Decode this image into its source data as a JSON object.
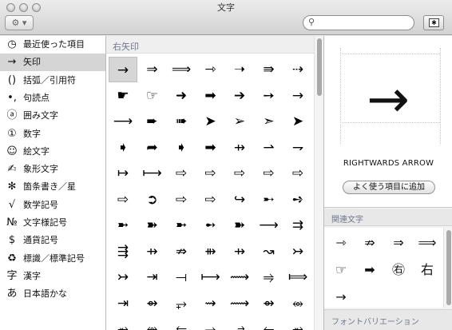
{
  "window": {
    "title": "文字"
  },
  "toolbar": {
    "gear_label": "⚙ ▾",
    "search_placeholder": "",
    "view_toggle_label": "✱"
  },
  "sidebar": {
    "selected_index": 1,
    "items": [
      {
        "icon": "◷",
        "icon_name": "clock-icon",
        "label": "最近使った項目"
      },
      {
        "icon": "→",
        "icon_name": "arrow-icon",
        "label": "矢印"
      },
      {
        "icon": "()",
        "icon_name": "parentheses-icon",
        "label": "括弧／引用符"
      },
      {
        "icon": "•,",
        "icon_name": "punctuation-icon",
        "label": "句読点"
      },
      {
        "icon": "ⓐ",
        "icon_name": "enclosed-letter-icon",
        "label": "囲み文字"
      },
      {
        "icon": "①",
        "icon_name": "digit-icon",
        "label": "数字"
      },
      {
        "icon": "☺",
        "icon_name": "smiley-icon",
        "label": "絵文字"
      },
      {
        "icon": "✍",
        "icon_name": "writing-hand-icon",
        "label": "象形文字"
      },
      {
        "icon": "✻",
        "icon_name": "asterisk-icon",
        "label": "箇条書き／星"
      },
      {
        "icon": "√",
        "icon_name": "square-root-icon",
        "label": "数学記号"
      },
      {
        "icon": "№",
        "icon_name": "numero-icon",
        "label": "文字様記号"
      },
      {
        "icon": "$",
        "icon_name": "dollar-icon",
        "label": "通貨記号"
      },
      {
        "icon": "♻",
        "icon_name": "recycle-icon",
        "label": "標識／標準記号"
      },
      {
        "icon": "字",
        "icon_name": "kanji-icon",
        "label": "漢字"
      },
      {
        "icon": "あ",
        "icon_name": "hiragana-icon",
        "label": "日本語かな"
      }
    ]
  },
  "main": {
    "section_title": "右矢印",
    "selected_char_index": 0,
    "characters": [
      "→",
      "⇒",
      "⟹",
      "⇾",
      "➝",
      "⇛",
      "⇢",
      "☛",
      "☞",
      "➜",
      "➡",
      "➔",
      "➙",
      "→",
      "⟶",
      "➨",
      "➠",
      "➤",
      "➢",
      "➣",
      "➤",
      "➧",
      "➦",
      "➧",
      "➡",
      "⇸",
      "⇀",
      "⇁",
      "↦",
      "⟼",
      "⇨",
      "⇨",
      "⇨",
      "⇨",
      "⇨",
      "⇨",
      "➲",
      "⇨",
      "⇨",
      "↪",
      "➸",
      "➺",
      "➼",
      "➽",
      "➼",
      "➻",
      "➽",
      "⟶",
      "⇉",
      "⇶",
      "⇸",
      "⇏",
      "⇻",
      "⇸",
      "↝",
      "↣",
      "↣",
      "⇥",
      "⟞",
      "⟼",
      "⟿",
      "⥤",
      "⟾",
      "⇥",
      "⇴",
      "⥅",
      "⇝",
      "⟿",
      "⇴",
      "⥈",
      "⥇",
      "⥈",
      "⥃",
      "⥅",
      "⥄",
      "⥆",
      "⥇"
    ]
  },
  "detail": {
    "glyph": "→",
    "char_name": "RIGHTWARDS ARROW",
    "fav_button_label": "よく使う項目に追加",
    "related_title": "関連文字",
    "related": [
      "⇾",
      "⇏",
      "⇒",
      "⟹",
      "☞",
      "➡",
      "㊨",
      "右",
      "→"
    ],
    "font_variation_title": "フォントバリエーション"
  }
}
